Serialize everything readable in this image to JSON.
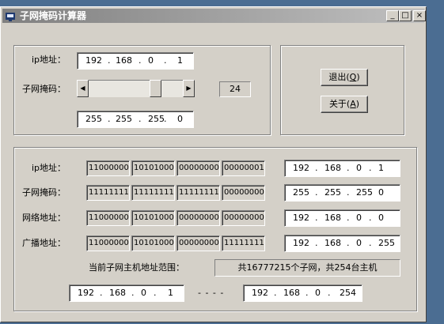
{
  "window": {
    "title": "子网掩码计算器"
  },
  "caption_buttons": {
    "minimize": "_",
    "maximize": "□",
    "close": "×"
  },
  "top": {
    "ip_label": "ip地址：",
    "ip": [
      "192",
      "168",
      "0",
      "1"
    ],
    "mask_label": "子网掩码：",
    "prefix_length": "24",
    "mask": [
      "255",
      "255",
      "255",
      "0"
    ]
  },
  "buttons": {
    "exit_text": "退出(",
    "exit_key": "Q",
    "exit_close": ")",
    "about_text": "关于(",
    "about_key": "A",
    "about_close": ")"
  },
  "rows": [
    {
      "label": "ip地址：",
      "bin": [
        "11000000",
        "10101000",
        "00000000",
        "00000001"
      ],
      "dec": [
        "192",
        "168",
        "0",
        "1"
      ]
    },
    {
      "label": "子网掩码：",
      "bin": [
        "11111111",
        "11111111",
        "11111111",
        "00000000"
      ],
      "dec": [
        "255",
        "255",
        "255",
        "0"
      ]
    },
    {
      "label": "网络地址：",
      "bin": [
        "11000000",
        "10101000",
        "00000000",
        "00000000"
      ],
      "dec": [
        "192",
        "168",
        "0",
        "0"
      ]
    },
    {
      "label": "广播地址：",
      "bin": [
        "11000000",
        "10101000",
        "00000000",
        "11111111"
      ],
      "dec": [
        "192",
        "168",
        "0",
        "255"
      ]
    }
  ],
  "range": {
    "label": "当前子网主机地址范围：",
    "summary": "共16777215个子网，共254台主机",
    "start": [
      "192",
      "168",
      "0",
      "1"
    ],
    "separator": "- - - -",
    "end": [
      "192",
      "168",
      "0",
      "254"
    ]
  },
  "slider": {
    "min": 1,
    "max": 32,
    "value": 24
  }
}
